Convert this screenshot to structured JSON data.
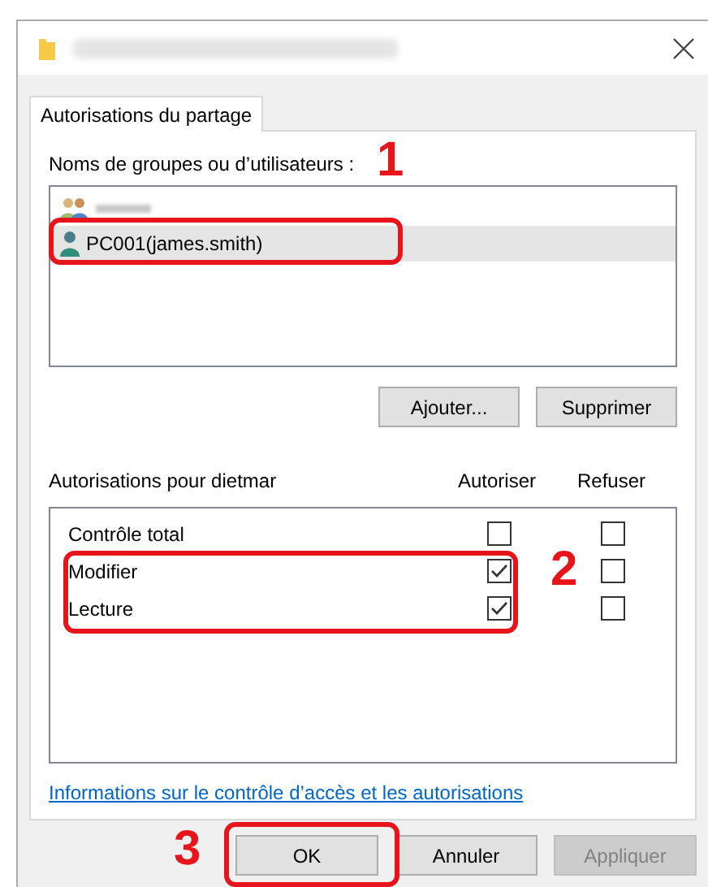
{
  "tabs": [
    {
      "label": "Autorisations du partage",
      "selected": true
    }
  ],
  "users": {
    "label": "Noms de groupes ou d’utilisateurs :",
    "items": [
      {
        "kind": "group",
        "redacted": true,
        "selected": false
      },
      {
        "kind": "user",
        "name": "PC001(james.smith)",
        "selected": true
      }
    ]
  },
  "user_buttons": [
    "Ajouter...",
    "Supprimer"
  ],
  "permissions": {
    "label": "Autorisations pour dietmar",
    "columns": [
      "Autoriser",
      "Refuser"
    ],
    "rows": [
      {
        "name": "Contrôle total",
        "allow": false,
        "deny": false
      },
      {
        "name": "Modifier",
        "allow": true,
        "deny": false
      },
      {
        "name": "Lecture",
        "allow": true,
        "deny": false
      }
    ]
  },
  "link": "Informations sur le contrôle d’accès et les autorisations",
  "buttons": [
    {
      "label": "OK",
      "disabled": false
    },
    {
      "label": "Annuler",
      "disabled": false
    },
    {
      "label": "Appliquer",
      "disabled": true
    }
  ],
  "annotations": [
    {
      "label": "1"
    },
    {
      "label": "2"
    },
    {
      "label": "3"
    }
  ]
}
